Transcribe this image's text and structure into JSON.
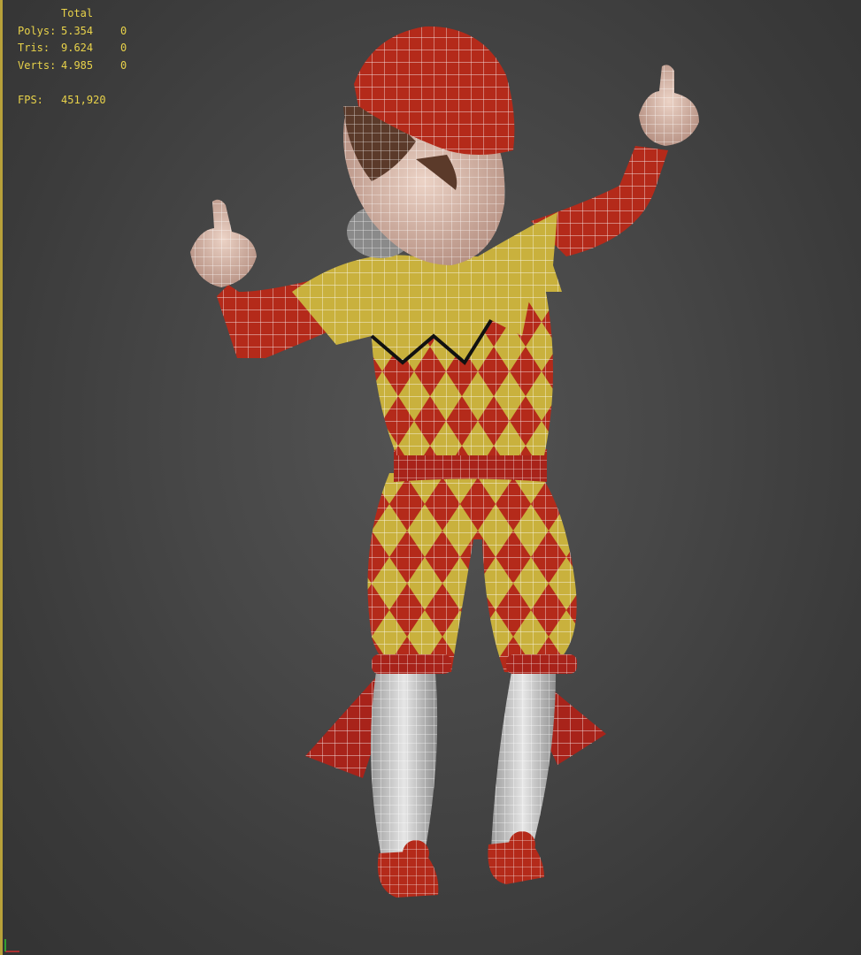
{
  "stats": {
    "header": "Total",
    "rows": [
      {
        "label": "Polys:",
        "total": "5.354",
        "selected": "0"
      },
      {
        "label": "Tris:",
        "total": "9.624",
        "selected": "0"
      },
      {
        "label": "Verts:",
        "total": "4.985",
        "selected": "0"
      }
    ],
    "fps": {
      "label": "FPS:",
      "value": "451,920"
    }
  },
  "colors": {
    "background": "#3a3a3a",
    "stats_text": "#e8d24a",
    "wireframe": "#ffffff",
    "costume_red": "#b42a1a",
    "costume_yellow": "#c9b13d",
    "skin": "#d9b8a8",
    "stocking": "#cfcfcf"
  },
  "model": {
    "description_icon": "jester-character-wireframe-icon"
  }
}
